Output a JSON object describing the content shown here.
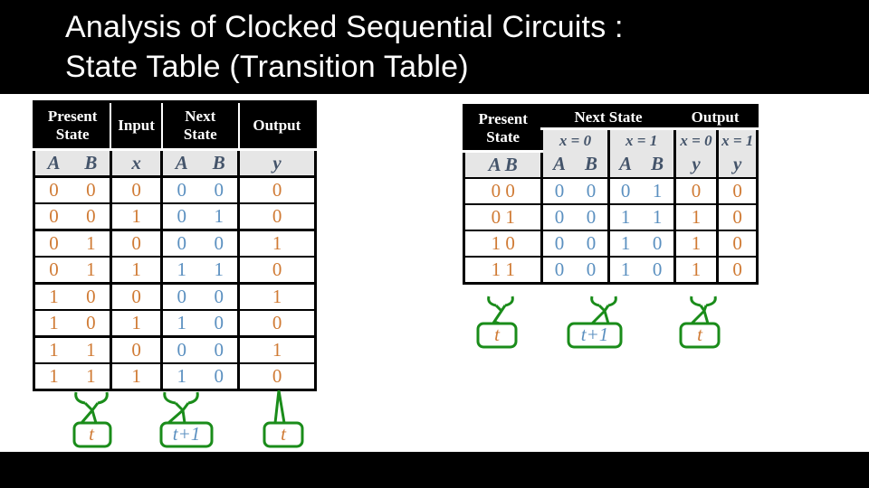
{
  "title": {
    "line1": "Analysis of Clocked Sequential Circuits :",
    "line2": "State Table (Transition Table)"
  },
  "colors": {
    "present_state": "#d07b35",
    "next_state": "#5b90c0",
    "callout_border": "#1a8c1a",
    "header_bg": "#000000",
    "subheader_bg": "#e6e6e6"
  },
  "left_table": {
    "headers": {
      "present_state": [
        "Present",
        "State"
      ],
      "input": "Input",
      "next_state": [
        "Next",
        "State"
      ],
      "output": "Output"
    },
    "subheaders": [
      "A",
      "B",
      "x",
      "A",
      "B",
      "y"
    ],
    "rows": [
      [
        "0",
        "0",
        "0",
        "0",
        "0",
        "0"
      ],
      [
        "0",
        "0",
        "1",
        "0",
        "1",
        "0"
      ],
      [
        "0",
        "1",
        "0",
        "0",
        "0",
        "1"
      ],
      [
        "0",
        "1",
        "1",
        "1",
        "1",
        "0"
      ],
      [
        "1",
        "0",
        "0",
        "0",
        "0",
        "1"
      ],
      [
        "1",
        "0",
        "1",
        "1",
        "0",
        "0"
      ],
      [
        "1",
        "1",
        "0",
        "0",
        "0",
        "1"
      ],
      [
        "1",
        "1",
        "1",
        "1",
        "0",
        "0"
      ]
    ],
    "callouts": [
      "t",
      "t+1",
      "t"
    ]
  },
  "right_table": {
    "headers": {
      "present_state": [
        "Present",
        "State"
      ],
      "next_state": "Next State",
      "output": "Output",
      "x0": "x = 0",
      "x1": "x = 1",
      "y_x0": "x = 0",
      "y_x1": "x = 1"
    },
    "subheaders": [
      "A B",
      "A",
      "B",
      "A",
      "B",
      "y",
      "y"
    ],
    "rows": [
      [
        "0 0",
        "0",
        "0",
        "0",
        "1",
        "0",
        "0"
      ],
      [
        "0 1",
        "0",
        "0",
        "1",
        "1",
        "1",
        "0"
      ],
      [
        "1 0",
        "0",
        "0",
        "1",
        "0",
        "1",
        "0"
      ],
      [
        "1 1",
        "0",
        "0",
        "1",
        "0",
        "1",
        "0"
      ]
    ],
    "callouts": [
      "t",
      "t+1",
      "t"
    ]
  }
}
